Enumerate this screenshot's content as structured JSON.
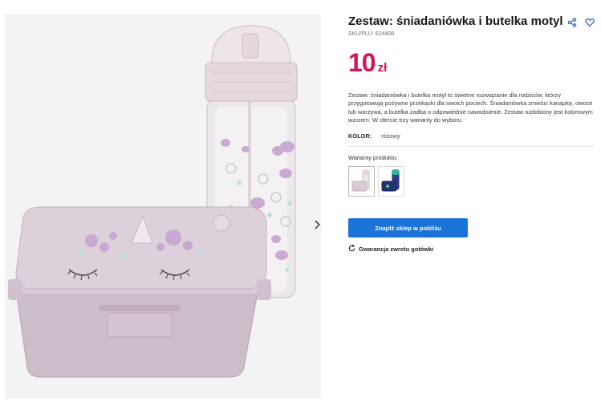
{
  "product": {
    "title": "Zestaw: śniadaniówka i butelka motyl",
    "sku": "SKU/PLU: 624408",
    "price_value": "10",
    "price_currency": "zł",
    "description": "Zestaw: śniadaniówka i butelka motyl to świetne rozwiązanie dla rodziców, którzy przygotowują pożywne przekąski dla swoich pociech. Śniadaniówka zmieści kanapkę, owoce lub warzywa, a butelka zadba o odpowiednie nawodnienie. Zestaw ozdobiony jest kolorowym wzorem. W ofercie trzy warianty do wyboru.",
    "color_label": "KOLOR:",
    "color_value": "różowy",
    "variants_label": "Warianty produktu:",
    "cta_label": "Znajdź sklep w pobliżu",
    "guarantee_label": "Gwarancja zwrotu gotówki"
  },
  "icons": {
    "share": "share-icon",
    "favorite": "heart-icon",
    "next": "chevron-right-icon",
    "guarantee": "refresh-icon"
  },
  "colors": {
    "price": "#d4145a",
    "cta": "#1a73d9",
    "lunchbox": "#d9ccd8",
    "bottle_cap": "#ebe0e4"
  }
}
